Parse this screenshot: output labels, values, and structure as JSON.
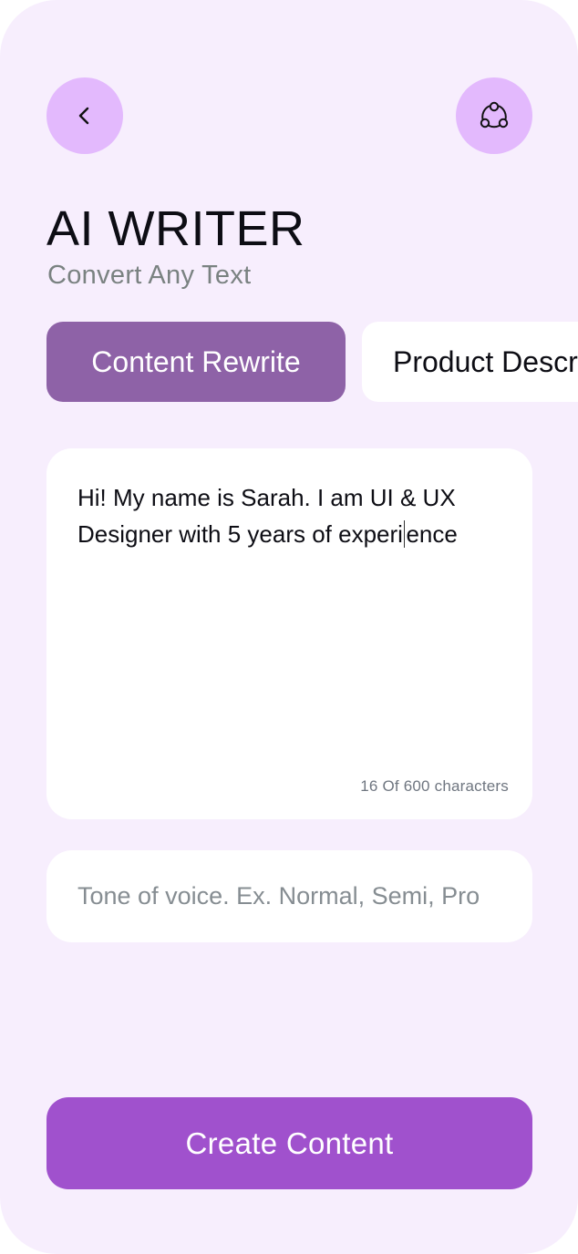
{
  "header": {
    "back_icon": "chevron-left-icon",
    "share_icon": "share-nodes-icon",
    "title": "AI WRITER",
    "subtitle": "Convert Any Text"
  },
  "tabs": [
    {
      "label": "Content Rewrite",
      "active": true
    },
    {
      "label": "Product Description",
      "active": false
    }
  ],
  "editor": {
    "text_before_cursor": "Hi! My name is Sarah. I am UI & UX Designer with 5 years of experi",
    "text_after_cursor": "ence",
    "char_count": "16 Of 600 characters"
  },
  "tone": {
    "value": "",
    "placeholder": "Tone of voice. Ex. Normal, Semi, Pro"
  },
  "cta": {
    "label": "Create Content"
  },
  "colors": {
    "background": "#f7eefd",
    "circle_button": "#e3b9fd",
    "active_tab": "#8e62a7",
    "primary_button": "#a051cd",
    "subtitle": "#7a8281"
  }
}
